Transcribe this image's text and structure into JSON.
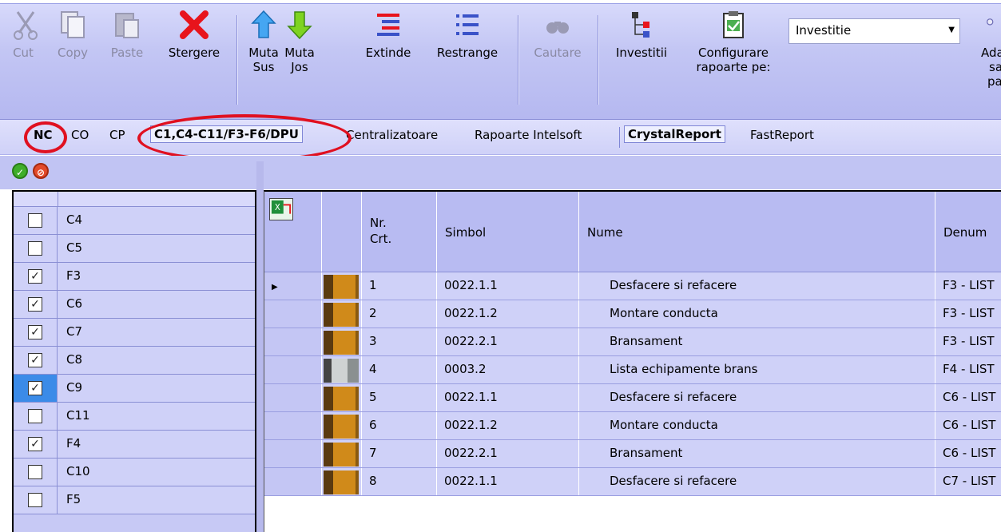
{
  "toolbar": {
    "cut": "Cut",
    "copy": "Copy",
    "paste": "Paste",
    "delete": "Stergere",
    "move_up": [
      "Muta",
      "Sus"
    ],
    "move_down": [
      "Muta",
      "Jos"
    ],
    "expand": "Extinde",
    "collapse": "Restrange",
    "search": "Cautare",
    "investments": "Investitii",
    "configure": [
      "Configurare",
      "rapoarte pe:"
    ],
    "combo_value": "Investitie",
    "add_partial": [
      "Ada",
      "sa",
      "pa"
    ]
  },
  "tabs": [
    {
      "label": "NC"
    },
    {
      "label": "CO"
    },
    {
      "label": "CP"
    },
    {
      "label": "C1,C4-C11/F3-F6/DPU"
    },
    {
      "label": "Centralizatoare"
    },
    {
      "label": "Rapoarte Intelsoft"
    },
    {
      "label": "CrystalReport"
    },
    {
      "label": "FastReport"
    }
  ],
  "left_list": [
    {
      "label": "C4",
      "checked": false
    },
    {
      "label": "C5",
      "checked": false
    },
    {
      "label": "F3",
      "checked": true
    },
    {
      "label": "C6",
      "checked": true
    },
    {
      "label": "C7",
      "checked": true
    },
    {
      "label": "C8",
      "checked": true
    },
    {
      "label": "C9",
      "checked": true
    },
    {
      "label": "C11",
      "checked": false
    },
    {
      "label": "F4",
      "checked": true
    },
    {
      "label": "C10",
      "checked": false
    },
    {
      "label": "F5",
      "checked": false
    }
  ],
  "grid": {
    "headers": {
      "nr": [
        "Nr.",
        "Crt."
      ],
      "symbol": "Simbol",
      "name": "Nume",
      "denum": "Denum"
    },
    "rows": [
      {
        "nr": "1",
        "simbol": "0022.1.1",
        "nume": "Desfacere si refacere",
        "denum": "F3 - LIST",
        "thumb": "orange"
      },
      {
        "nr": "2",
        "simbol": "0022.1.2",
        "nume": "Montare conducta",
        "denum": "F3 - LIST",
        "thumb": "orange"
      },
      {
        "nr": "3",
        "simbol": "0022.2.1",
        "nume": "Bransament",
        "denum": "F3 - LIST",
        "thumb": "orange"
      },
      {
        "nr": "4",
        "simbol": "0003.2",
        "nume": "Lista echipamente brans",
        "denum": "F4 - LIST",
        "thumb": "gray"
      },
      {
        "nr": "5",
        "simbol": "0022.1.1",
        "nume": "Desfacere si refacere",
        "denum": "C6 - LIST",
        "thumb": "orange"
      },
      {
        "nr": "6",
        "simbol": "0022.1.2",
        "nume": "Montare conducta",
        "denum": "C6 - LIST",
        "thumb": "orange"
      },
      {
        "nr": "7",
        "simbol": "0022.2.1",
        "nume": "Bransament",
        "denum": "C6 - LIST",
        "thumb": "orange"
      },
      {
        "nr": "8",
        "simbol": "0022.1.1",
        "nume": "Desfacere si refacere",
        "denum": "C7 - LIST",
        "thumb": "orange"
      }
    ]
  }
}
